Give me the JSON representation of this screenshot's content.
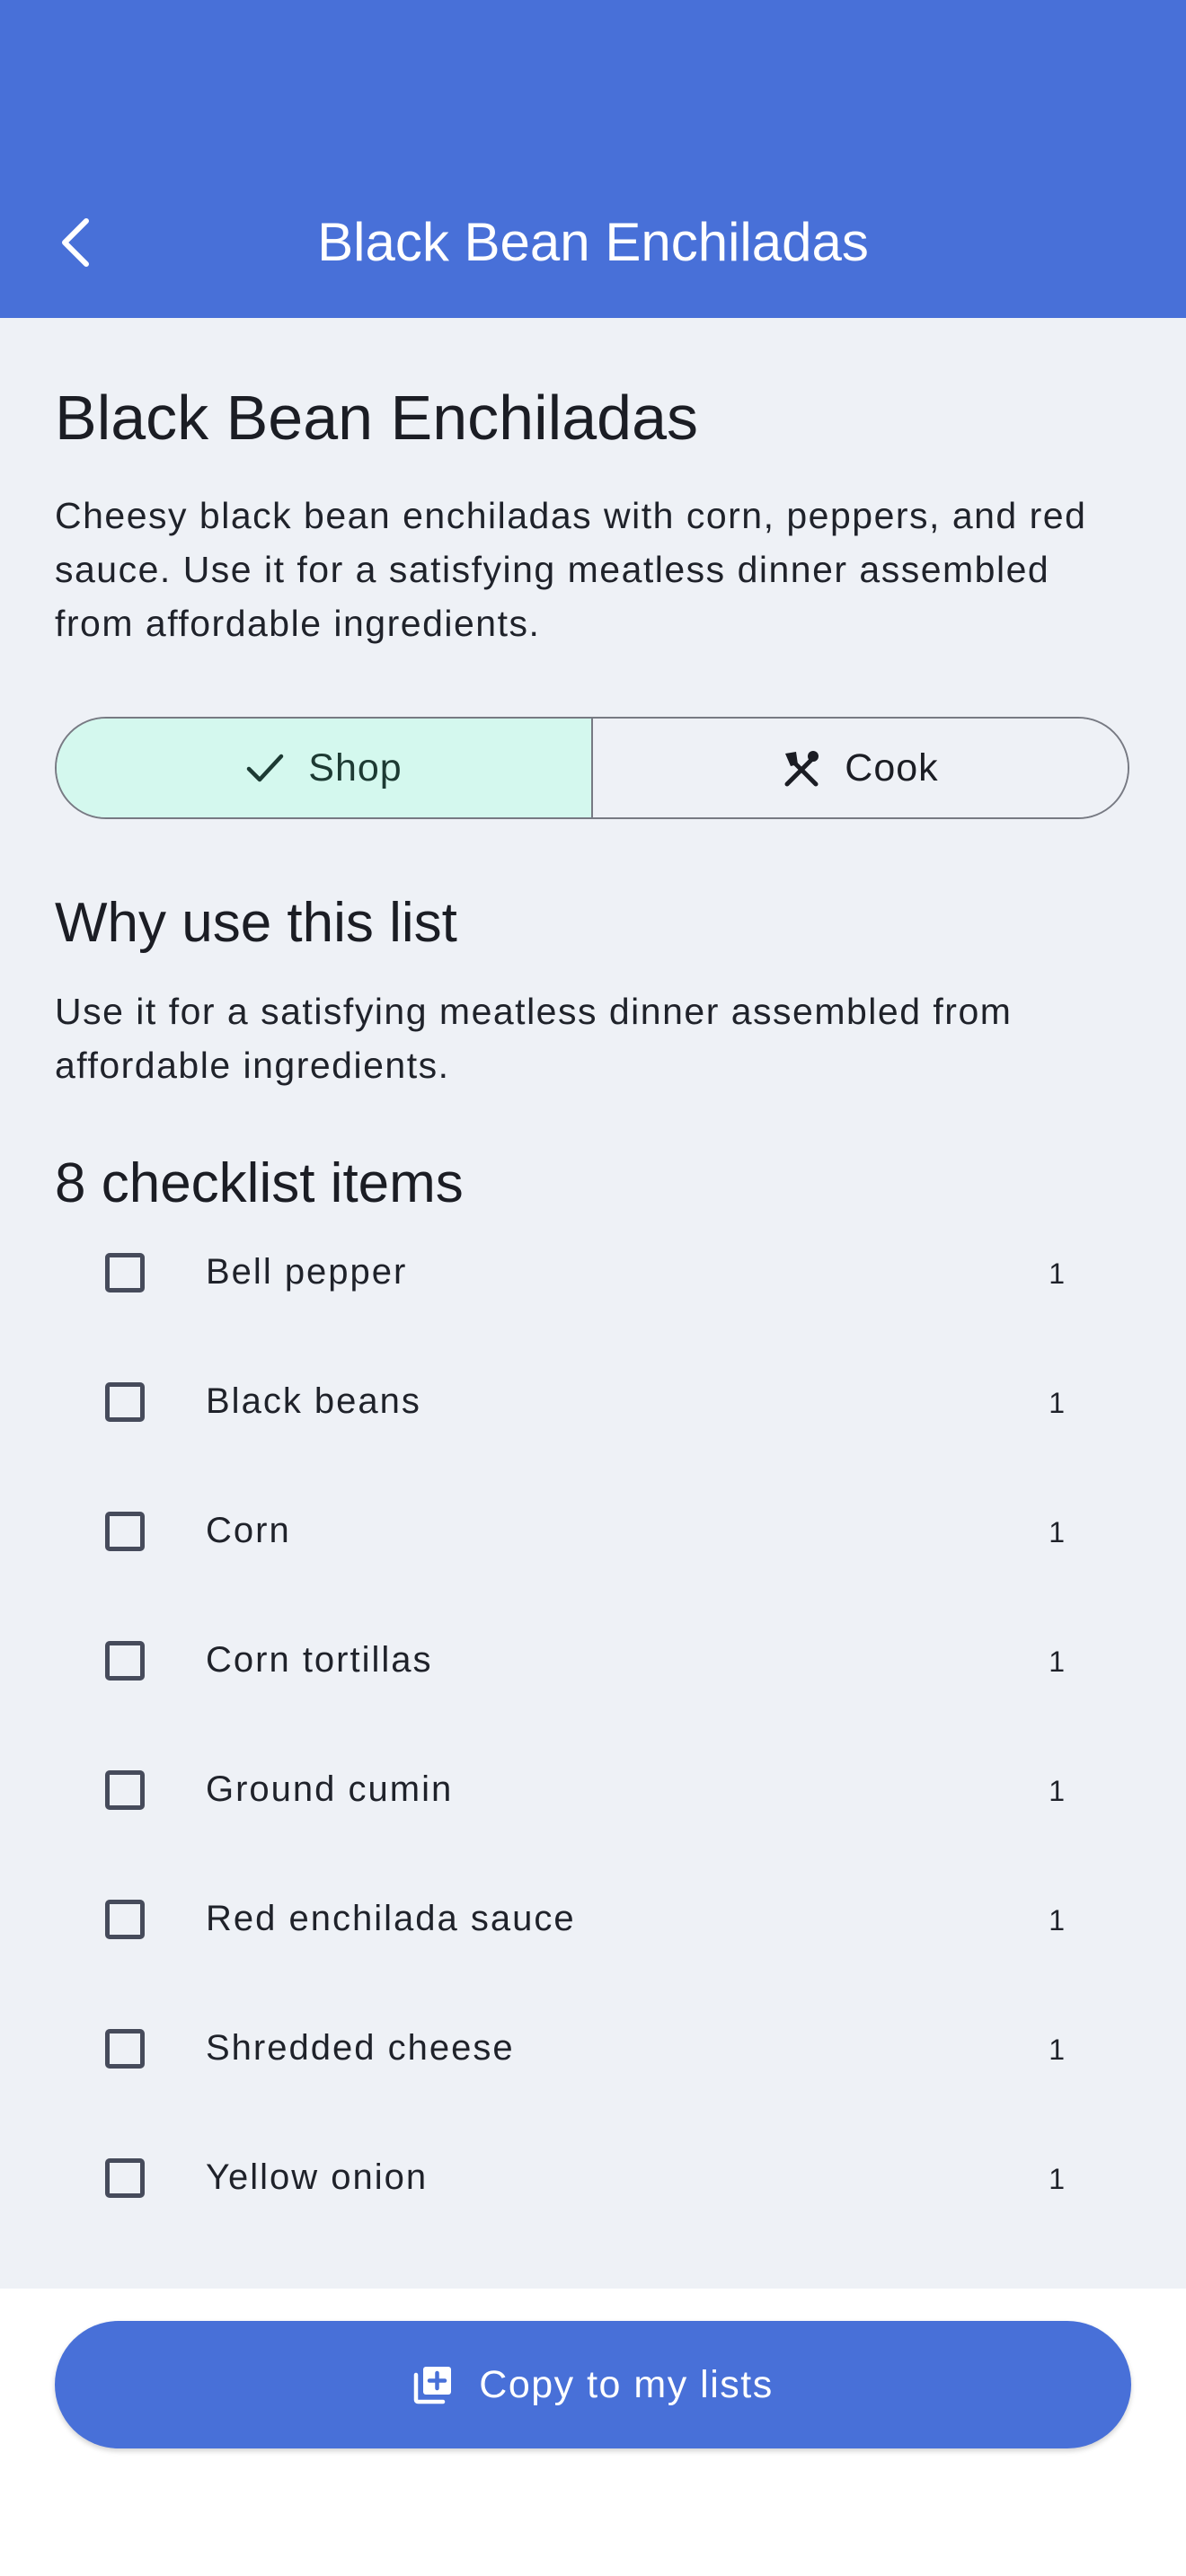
{
  "appbar": {
    "title": "Black Bean Enchiladas",
    "back_icon": "back-arrow-icon",
    "color": "#4870d8"
  },
  "recipe": {
    "title": "Black Bean Enchiladas",
    "description": "Cheesy black bean enchiladas with corn, peppers, and red sauce. Use it for a satisfying meatless dinner assembled from affordable ingredients."
  },
  "mode_toggle": {
    "shop_label": "Shop",
    "shop_icon": "check-icon",
    "cook_label": "Cook",
    "cook_icon": "utensils-icon",
    "selected": "Shop",
    "selected_color": "#d4f8ee"
  },
  "why": {
    "heading": "Why use this list",
    "text": "Use it for a satisfying meatless dinner assembled from affordable ingredients."
  },
  "checklist": {
    "heading": "8 checklist items",
    "items": [
      {
        "name": "Bell pepper",
        "qty": "1",
        "checked": false
      },
      {
        "name": "Black beans",
        "qty": "1",
        "checked": false
      },
      {
        "name": "Corn",
        "qty": "1",
        "checked": false
      },
      {
        "name": "Corn tortillas",
        "qty": "1",
        "checked": false
      },
      {
        "name": "Ground cumin",
        "qty": "1",
        "checked": false
      },
      {
        "name": "Red enchilada sauce",
        "qty": "1",
        "checked": false
      },
      {
        "name": "Shredded cheese",
        "qty": "1",
        "checked": false
      },
      {
        "name": "Yellow onion",
        "qty": "1",
        "checked": false
      }
    ]
  },
  "footer": {
    "copy_label": "Copy to my lists",
    "copy_icon": "library-add-icon",
    "button_color": "#4870d8"
  }
}
